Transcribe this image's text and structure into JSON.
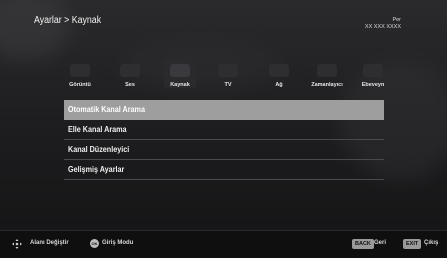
{
  "header": {
    "breadcrumb": "Ayarlar > Kaynak",
    "clock_day": "Per",
    "clock_time": "XX XXX XXXX"
  },
  "tabs": [
    {
      "label": "Görüntü",
      "icon": "picture-icon"
    },
    {
      "label": "Ses",
      "icon": "sound-icon"
    },
    {
      "label": "Kaynak",
      "icon": "source-icon"
    },
    {
      "label": "TV",
      "icon": "tv-icon"
    },
    {
      "label": "Ağ",
      "icon": "network-icon"
    },
    {
      "label": "Zamanlayıcı",
      "icon": "timer-icon"
    },
    {
      "label": "Ebeveyn",
      "icon": "parental-icon"
    }
  ],
  "active_tab": "Kaynak",
  "menu": [
    {
      "label": "Otomatik Kanal Arama",
      "selected": true
    },
    {
      "label": "Elle Kanal Arama",
      "selected": false
    },
    {
      "label": "Kanal Düzenleyici",
      "selected": false
    },
    {
      "label": "Gelişmiş Ayarlar",
      "selected": false
    }
  ],
  "footer": {
    "navigate_label": "Alanı Değiştir",
    "ok_key": "OK",
    "ok_label": "Giriş Modu",
    "back_key": "BACK",
    "back_label": "Geri",
    "exit_key": "EXIT",
    "exit_label": "Çıkış"
  },
  "colors": {
    "selected_row": "#9e9e9e",
    "background": "#1c1c1e",
    "key_badge": "#9a9a9a"
  }
}
